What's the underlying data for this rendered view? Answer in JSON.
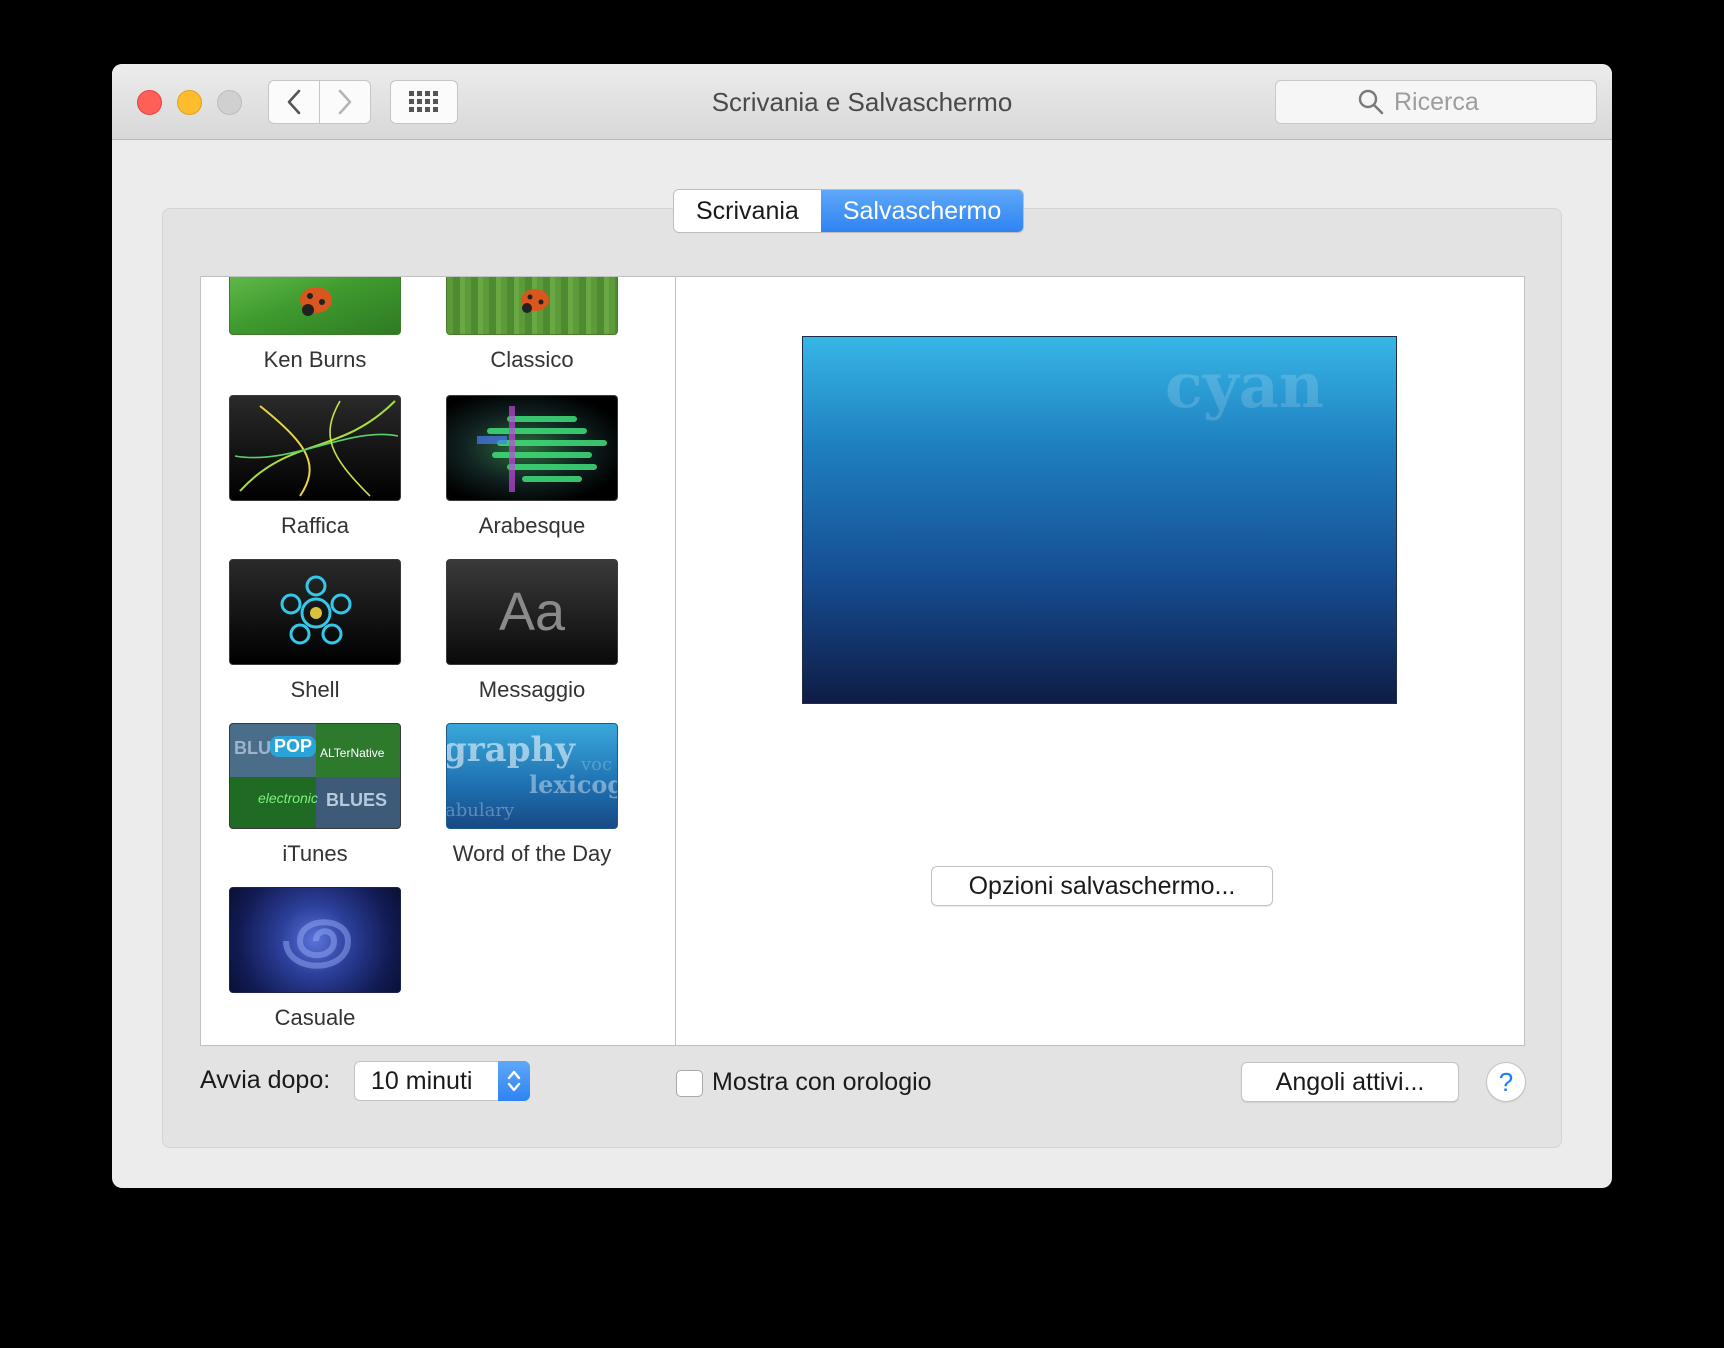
{
  "window": {
    "title": "Scrivania e Salvaschermo"
  },
  "search": {
    "placeholder": "Ricerca",
    "icon": "search-icon"
  },
  "tabs": [
    {
      "label": "Scrivania",
      "selected": false
    },
    {
      "label": "Salvaschermo",
      "selected": true
    }
  ],
  "screensavers": [
    {
      "name": "Ken Burns"
    },
    {
      "name": "Classico"
    },
    {
      "name": "Raffica"
    },
    {
      "name": "Arabesque"
    },
    {
      "name": "Shell"
    },
    {
      "name": "Messaggio",
      "thumb_text": "Aa"
    },
    {
      "name": "iTunes",
      "thumb_words": [
        "BLUES",
        "POP",
        "ALTerNative",
        "electronic"
      ]
    },
    {
      "name": "Word of the Day",
      "thumb_words": [
        "graphy",
        "lexicog",
        "abulary",
        "voc"
      ]
    },
    {
      "name": "Casuale"
    }
  ],
  "preview": {
    "word": "cyan"
  },
  "buttons": {
    "options": "Opzioni salvaschermo...",
    "hot_corners": "Angoli attivi...",
    "help": "?"
  },
  "start_after": {
    "label": "Avvia dopo:",
    "value": "10 minuti"
  },
  "show_clock": {
    "label": "Mostra con orologio",
    "checked": false
  },
  "colors": {
    "accent": "#2f83f2",
    "close": "#fe5f57",
    "minimize": "#febc2e"
  }
}
